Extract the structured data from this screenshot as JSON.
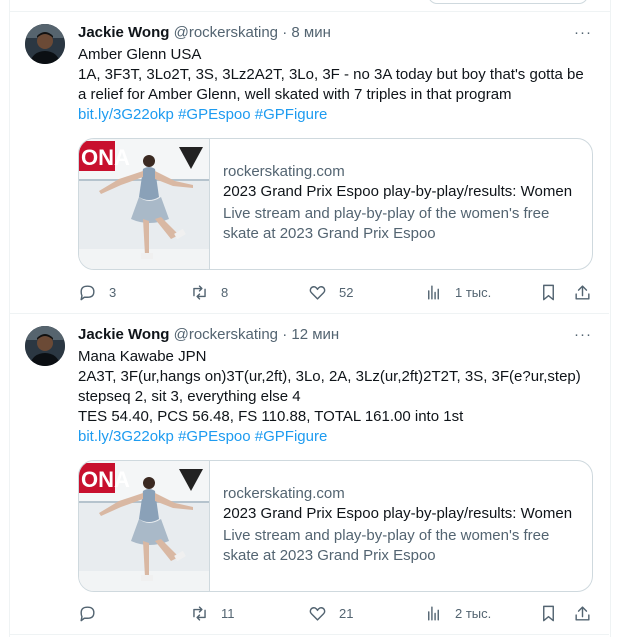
{
  "tweets": [
    {
      "author_name": "Jackie Wong",
      "handle": "@rockerskating",
      "separator": "·",
      "time": "8 мин",
      "more": "···",
      "lines": [
        "Amber Glenn USA",
        "1A, 3F3T, 3Lo2T, 3S, 3Lz2A2T, 3Lo, 3F - no 3A today but boy that's gotta be",
        "a relief for Amber Glenn, well skated with 7 triples in that program"
      ],
      "link_short": "bit.ly/3G22okp",
      "hashtag1": "#GPEspoo",
      "hashtag2": "#GPFigure",
      "card": {
        "domain": "rockerskating.com",
        "title": "2023 Grand Prix Espoo play-by-play/results: Women",
        "desc_line1": "Live stream and play-by-play of the women's free",
        "desc_line2": "skate at 2023 Grand Prix Espoo"
      },
      "replies": "3",
      "retweets": "8",
      "likes": "52",
      "views": "1 тыс."
    },
    {
      "author_name": "Jackie Wong",
      "handle": "@rockerskating",
      "separator": "·",
      "time": "12 мин",
      "more": "···",
      "lines": [
        "Mana Kawabe JPN",
        "2A3T, 3F(ur,hangs on)3T(ur,2ft), 3Lo, 2A, 3Lz(ur,2ft)2T2T, 3S, 3F(e?ur,step)",
        "stepseq 2, sit 3, everything else 4",
        "TES 54.40, PCS 56.48, FS 110.88, TOTAL 161.00 into 1st"
      ],
      "link_short": "bit.ly/3G22okp",
      "hashtag1": "#GPEspoo",
      "hashtag2": "#GPFigure",
      "card": {
        "domain": "rockerskating.com",
        "title": "2023 Grand Prix Espoo play-by-play/results: Women",
        "desc_line1": "Live stream and play-by-play of the women's free",
        "desc_line2": "skate at 2023 Grand Prix Espoo"
      },
      "replies": "",
      "retweets": "11",
      "likes": "21",
      "views": "2 тыс."
    }
  ],
  "colors": {
    "link": "#1d9bf0",
    "secondary_text": "#536471",
    "border": "#cfd9de"
  }
}
